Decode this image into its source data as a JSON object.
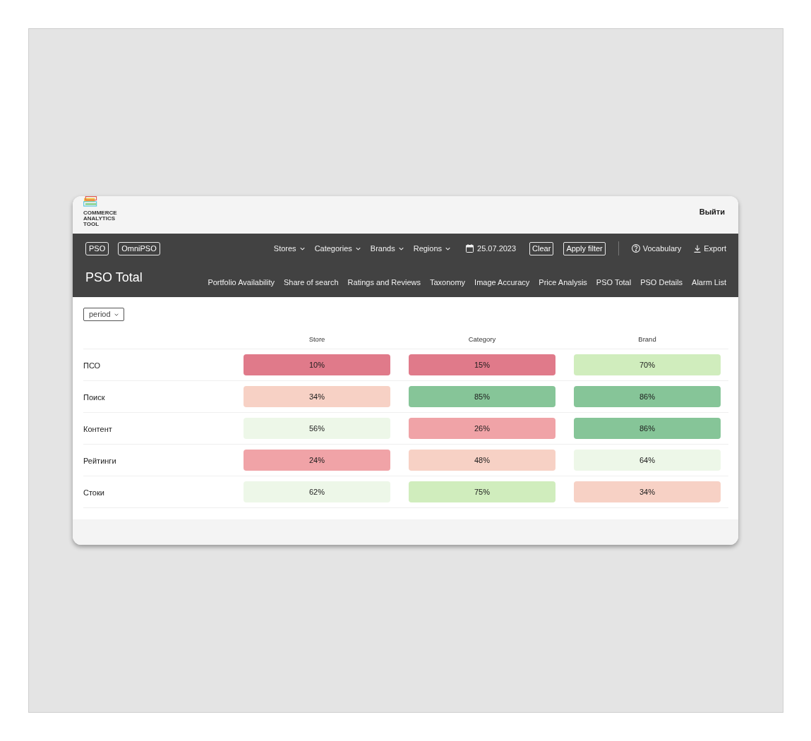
{
  "header": {
    "logo_text": "COMMERCE ANALYTICS TOOL",
    "logout": "Выйти"
  },
  "toolbar": {
    "modes": [
      {
        "label": "PSO"
      },
      {
        "label": "OmniPSO"
      }
    ],
    "filters": [
      {
        "label": "Stores"
      },
      {
        "label": "Categories"
      },
      {
        "label": "Brands"
      },
      {
        "label": "Regions"
      }
    ],
    "date": "25.07.2023",
    "actions": [
      {
        "label": "Clear"
      },
      {
        "label": "Apply filter"
      }
    ],
    "links": [
      {
        "label": "Vocabulary",
        "kind": "help"
      },
      {
        "label": "Export",
        "kind": "download"
      }
    ]
  },
  "page_title": "PSO Total",
  "tabs": [
    {
      "label": "Portfolio Availability"
    },
    {
      "label": "Share of search"
    },
    {
      "label": "Ratings and Reviews"
    },
    {
      "label": "Taxonomy"
    },
    {
      "label": "Image Accuracy"
    },
    {
      "label": "Price Analysis"
    },
    {
      "label": "PSO Total"
    },
    {
      "label": "PSO Details"
    },
    {
      "label": "Alarm List"
    }
  ],
  "period_select": {
    "value": "period"
  },
  "table": {
    "columns": [
      "Store",
      "Category",
      "Brand"
    ],
    "rows": [
      {
        "label": "ПСО",
        "cells": [
          {
            "value": "10%",
            "color": "#e07a8a"
          },
          {
            "value": "15%",
            "color": "#e07a8a"
          },
          {
            "value": "70%",
            "color": "#d0edbd"
          }
        ]
      },
      {
        "label": "Поиск",
        "cells": [
          {
            "value": "34%",
            "color": "#f7d1c5"
          },
          {
            "value": "85%",
            "color": "#86c598"
          },
          {
            "value": "86%",
            "color": "#86c598"
          }
        ]
      },
      {
        "label": "Контент",
        "cells": [
          {
            "value": "56%",
            "color": "#edf7e8"
          },
          {
            "value": "26%",
            "color": "#f0a3a7"
          },
          {
            "value": "86%",
            "color": "#86c598"
          }
        ]
      },
      {
        "label": "Рейтинги",
        "cells": [
          {
            "value": "24%",
            "color": "#f0a3a7"
          },
          {
            "value": "48%",
            "color": "#f7d1c5"
          },
          {
            "value": "64%",
            "color": "#edf7e8"
          }
        ]
      },
      {
        "label": "Стоки",
        "cells": [
          {
            "value": "62%",
            "color": "#edf7e8"
          },
          {
            "value": "75%",
            "color": "#d0edbd"
          },
          {
            "value": "34%",
            "color": "#f7d1c5"
          }
        ]
      }
    ]
  }
}
